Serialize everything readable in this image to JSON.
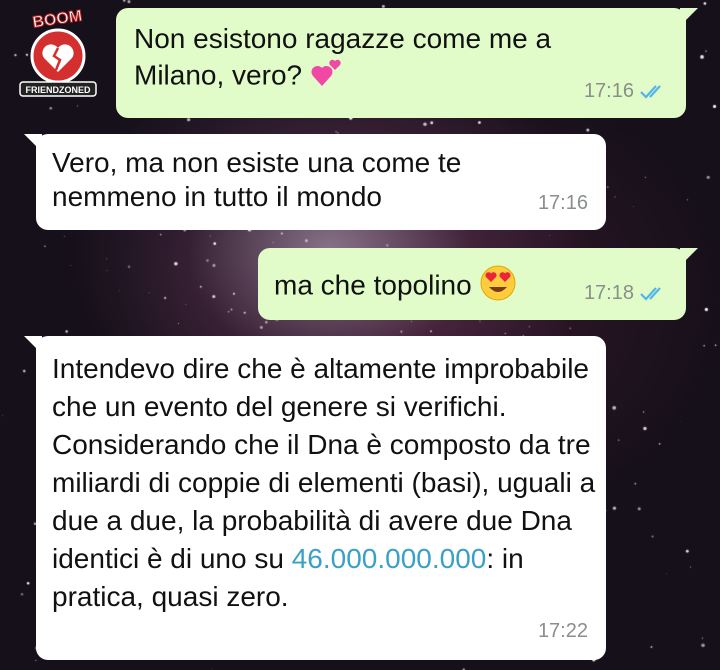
{
  "logo": {
    "top_text": "BOOM",
    "bottom_text": "FRIENDZONED"
  },
  "messages": [
    {
      "direction": "outgoing",
      "text": "Non esistono ragazze come me a Milano, vero?",
      "emoji": "two-hearts",
      "time": "17:16",
      "status": "read"
    },
    {
      "direction": "incoming",
      "text": "Vero, ma non esiste una come te nemmeno in tutto il mondo",
      "time": "17:16"
    },
    {
      "direction": "outgoing",
      "text": "ma che topolino",
      "emoji": "heart-eyes",
      "time": "17:18",
      "status": "read"
    },
    {
      "direction": "incoming",
      "text_before": "Intendevo dire che è altamente improbabile che un evento del genere si verifichi. Considerando che il Dna è composto da tre miliardi di coppie di elementi (basi), uguali a due a due, la probabilità di avere due Dna identici è di uno su",
      "link": "46.000.000.000",
      "text_after": ": in pratica, quasi zero.",
      "time": "17:22"
    }
  ],
  "colors": {
    "outgoing_bubble": "#e2fcc9",
    "incoming_bubble": "#ffffff",
    "read_ticks": "#4fb6ec",
    "timestamp": "#8a8f8a",
    "link": "#3aa0c8"
  }
}
